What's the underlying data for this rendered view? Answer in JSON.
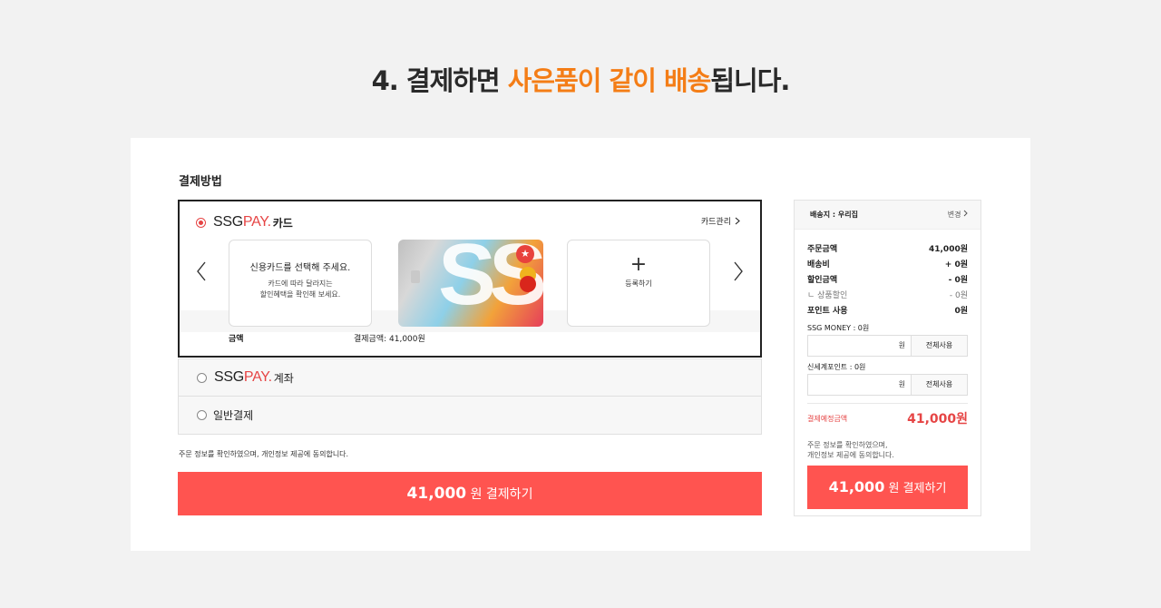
{
  "headline": {
    "prefix": "4. 결제하면 ",
    "highlight": "사은품이 같이 배송",
    "suffix": "됩니다."
  },
  "colors": {
    "accent": "#ff5450",
    "brand_orange": "#f47d16",
    "pay_red": "#e64545"
  },
  "payment": {
    "section_title": "결제방법",
    "card_method": {
      "logo_ssg": "SSG",
      "logo_pay": "PAY.",
      "label": "카드",
      "manage_link": "카드관리",
      "slide_select_title": "신용카드를 선택해 주세요.",
      "slide_select_desc_1": "카드에 따라 달라지는",
      "slide_select_desc_2": "할인혜택을 확인해 보세요.",
      "card_text": "SSG",
      "register_plus": "+",
      "register_label": "등록하기",
      "amount_label": "금액",
      "amount_value": "결제금액: 41,000원"
    },
    "account_method": {
      "logo_ssg": "SSG",
      "logo_pay": "PAY.",
      "label": "계좌"
    },
    "general_method": {
      "label": "일반결제"
    },
    "agreement": "주문 정보를 확인하였으며, 개인정보 제공에 동의합니다.",
    "pay_button": {
      "amount": "41,000",
      "text": "원 결제하기"
    }
  },
  "summary": {
    "shipping": "배송지 : 우리집",
    "change": "변경",
    "lines": [
      {
        "label": "주문금액",
        "value": "41,000원",
        "sub": false
      },
      {
        "label": "배송비",
        "value": "+ 0원",
        "sub": false
      },
      {
        "label": "할인금액",
        "value": "- 0원",
        "sub": false
      },
      {
        "label": "ㄴ 상품할인",
        "value": "- 0원",
        "sub": true
      },
      {
        "label": "포인트 사용",
        "value": "0원",
        "sub": false
      }
    ],
    "ssg_money_label": "SSG MONEY : 0원",
    "shinsegae_point_label": "신세계포인트 : 0원",
    "won_unit": "원",
    "use_all": "전체사용",
    "expected_label": "결제예정금액",
    "expected_value": "41,000원",
    "note_1": "주문 정보를 확인하였으며,",
    "note_2": "개인정보 제공에 동의합니다.",
    "pay_button": {
      "amount": "41,000",
      "text": "원 결제하기"
    }
  }
}
